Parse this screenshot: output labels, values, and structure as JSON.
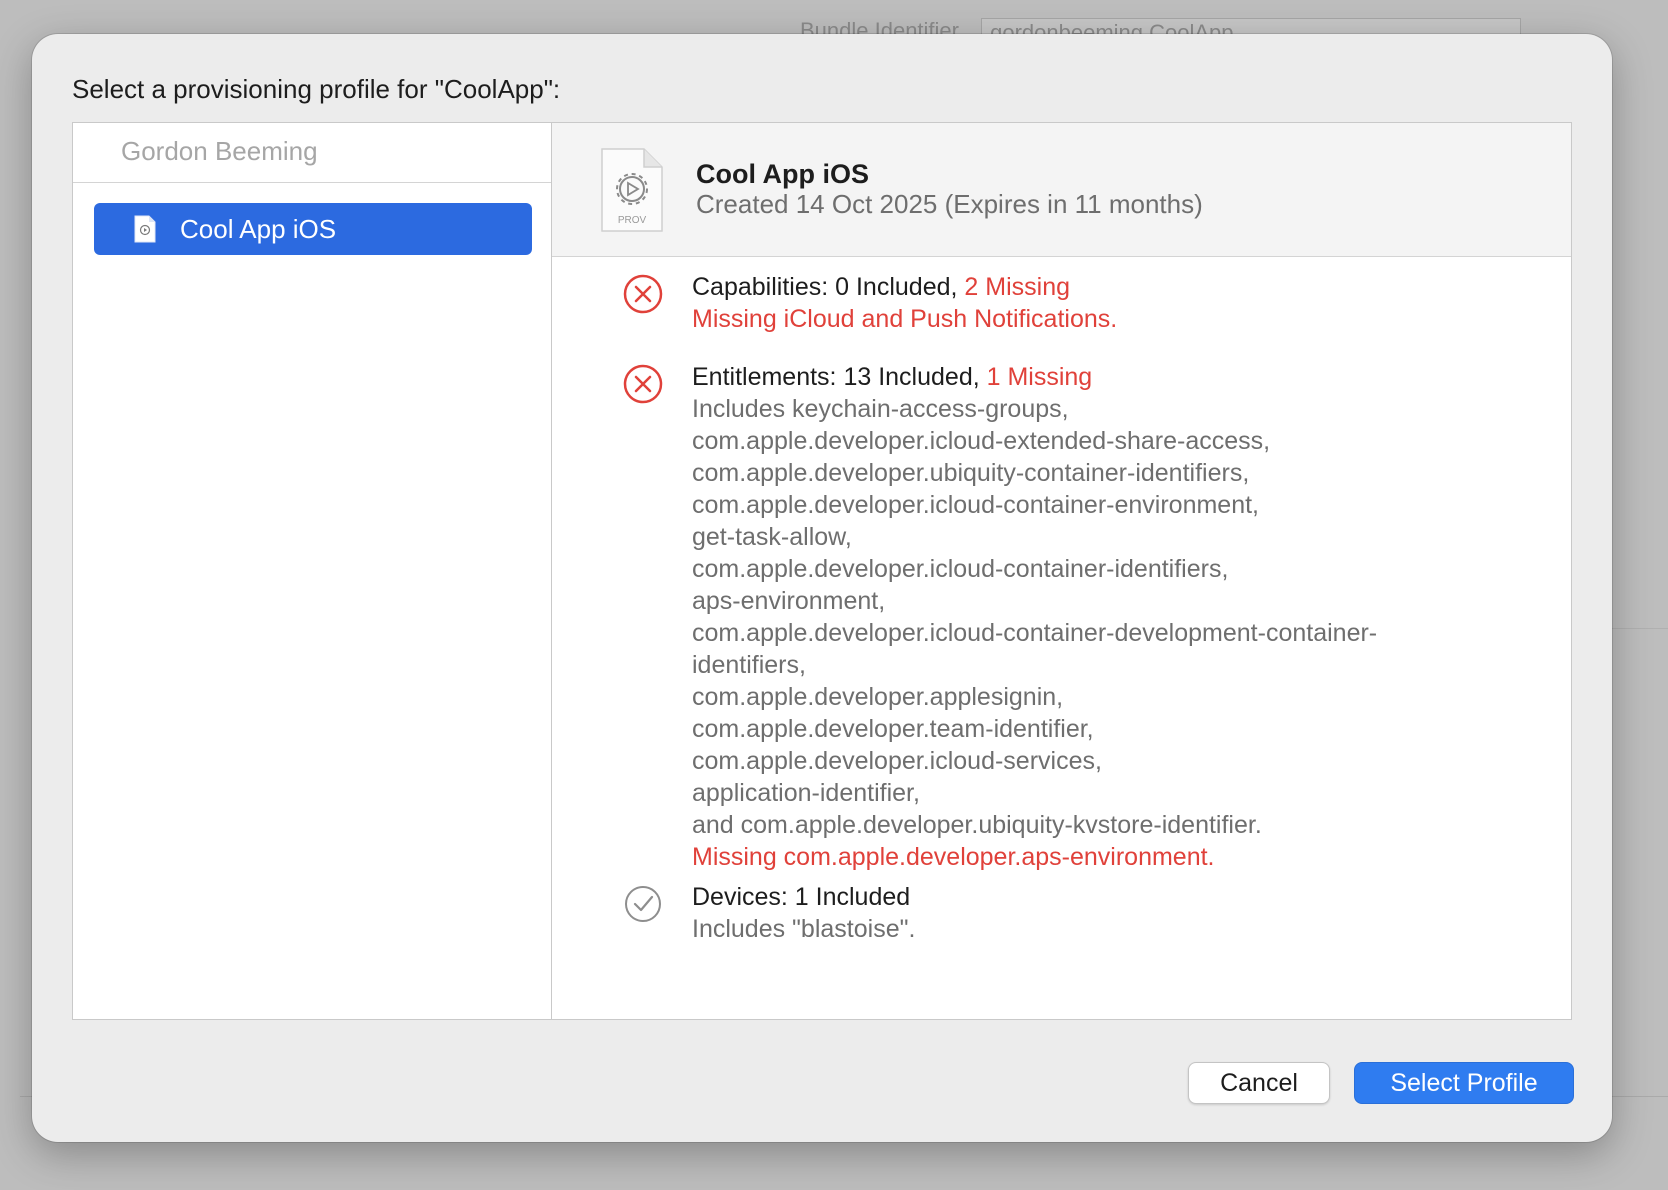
{
  "background": {
    "bundle_label": "Bundle Identifier",
    "bundle_value": "gordonbeeming.CoolApp"
  },
  "dialog": {
    "title": "Select a provisioning profile for \"CoolApp\":"
  },
  "sidebar": {
    "team_name": "Gordon Beeming",
    "items": [
      {
        "label": "Cool App iOS",
        "selected": true
      }
    ]
  },
  "profile": {
    "icon_label": "PROV",
    "name": "Cool App iOS",
    "created": "Created 14 Oct 2025 (Expires in 11 months)"
  },
  "capabilities": {
    "status": "error",
    "head": "Capabilities: 0 Included,",
    "missing_count": "2 Missing",
    "missing_detail": "Missing iCloud and Push Notifications."
  },
  "entitlements": {
    "status": "error",
    "head": "Entitlements: 13 Included,",
    "missing_count": "1 Missing",
    "lines": [
      "Includes keychain-access-groups,",
      "com.apple.developer.icloud-extended-share-access,",
      "com.apple.developer.ubiquity-container-identifiers,",
      "com.apple.developer.icloud-container-environment,",
      "get-task-allow,",
      "com.apple.developer.icloud-container-identifiers,",
      "aps-environment,",
      "com.apple.developer.icloud-container-development-container-",
      "identifiers,",
      "com.apple.developer.applesignin,",
      "com.apple.developer.team-identifier,",
      "com.apple.developer.icloud-services,",
      "application-identifier,",
      "and com.apple.developer.ubiquity-kvstore-identifier."
    ],
    "missing_detail": "Missing com.apple.developer.aps-environment."
  },
  "devices": {
    "status": "ok",
    "head": "Devices: 1 Included",
    "detail": "Includes \"blastoise\"."
  },
  "buttons": {
    "cancel": "Cancel",
    "select": "Select Profile"
  },
  "colors": {
    "accent": "#2c6ae0",
    "error": "#e0413a",
    "primary_button": "#2f7cf0"
  }
}
